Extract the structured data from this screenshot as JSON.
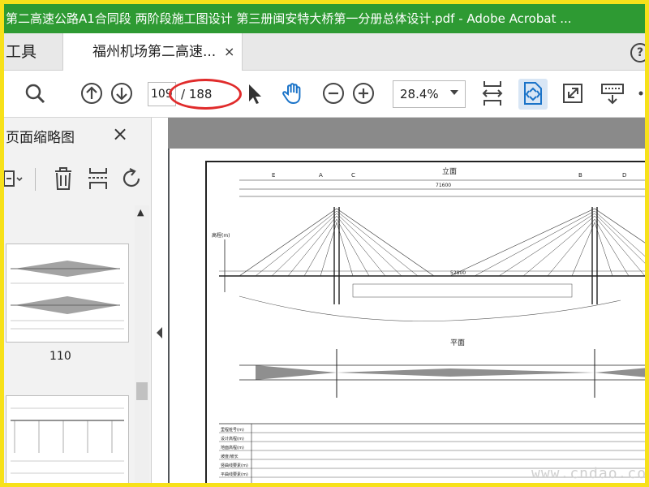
{
  "window": {
    "title": "第二高速公路A1合同段 两阶段施工图设计 第三册闽安特大桥第一分册总体设计.pdf - Adobe Acrobat ..."
  },
  "tabs": {
    "tools_label": "工具",
    "document_label": "福州机场第二高速...",
    "close_glyph": "×",
    "help_glyph": "?"
  },
  "toolbar": {
    "page_current": "109",
    "page_total": "/ 188",
    "zoom": "28.4%"
  },
  "sidebar": {
    "title": "页面缩略图",
    "close_glyph": "×",
    "thumbnails": [
      {
        "label": "110"
      }
    ]
  },
  "drawing": {
    "elevation_title": "立面",
    "plan_title": "平面",
    "span_total": "71600",
    "main_span": "52800",
    "axis_marks": [
      "E",
      "A",
      "C",
      "B",
      "D"
    ],
    "elevation_label": "高程(m)",
    "table_rows": [
      "里程桩号(m)",
      "设计高程(m)",
      "地面高程(m)",
      "坡度/坡长",
      "竖曲线要素(m)",
      "平曲线要素(m)"
    ]
  },
  "watermark": "www.cndao.com",
  "colors": {
    "titlebar": "#2e9a33",
    "frame": "#f7e11a",
    "annotation": "#e02b2b",
    "accent": "#1a73c8"
  }
}
